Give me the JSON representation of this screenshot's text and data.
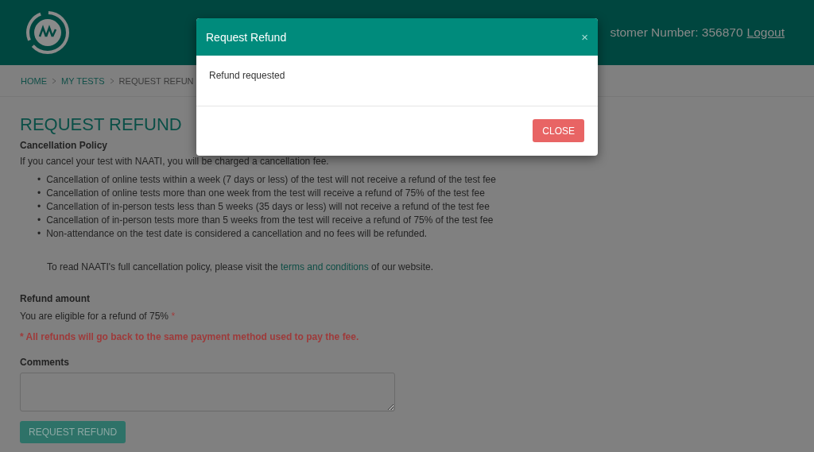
{
  "header": {
    "customer_number": "stomer Number: 356870",
    "logout": "Logout"
  },
  "breadcrumb": [
    {
      "label": "HOME",
      "kind": "link"
    },
    {
      "label": "MY TESTS",
      "kind": "link"
    },
    {
      "label": "REQUEST REFUN",
      "kind": "current"
    }
  ],
  "page": {
    "title": "REQUEST REFUND",
    "policy_heading": "Cancellation Policy",
    "policy_intro": "If you cancel your test with NAATI, you will be charged a cancellation fee.",
    "bullet": "•",
    "policy_items": [
      "Cancellation of online tests within a week (7 days or less) of the test will not receive a refund of the test fee",
      "Cancellation of online tests more than one week from the test will receive a refund of 75% of the test fee",
      "Cancellation of in-person tests less than 5 weeks (35 days or less) will not receive a refund of the test fee",
      "Cancellation of in-person tests more than 5 weeks from the test will receive a refund of 75% of the test fee",
      "Non-attendance on the test date is considered a cancellation and no fees will be refunded."
    ],
    "policy_link_before": "To read NAATI's full cancellation policy, please visit the",
    "policy_link": "terms and conditions",
    "policy_link_after": "of our website.",
    "refund_heading": "Refund amount",
    "refund_text": "You are eligible for a refund of 75%",
    "refund_mark": "*",
    "refund_notice": "* All refunds will go back to the same payment method used to pay the fee.",
    "comments_label": "Comments",
    "submit": "REQUEST REFUND"
  },
  "modal": {
    "title": "Request Refund",
    "close_icon": "×",
    "message": "Refund requested",
    "button": "CLOSE"
  }
}
